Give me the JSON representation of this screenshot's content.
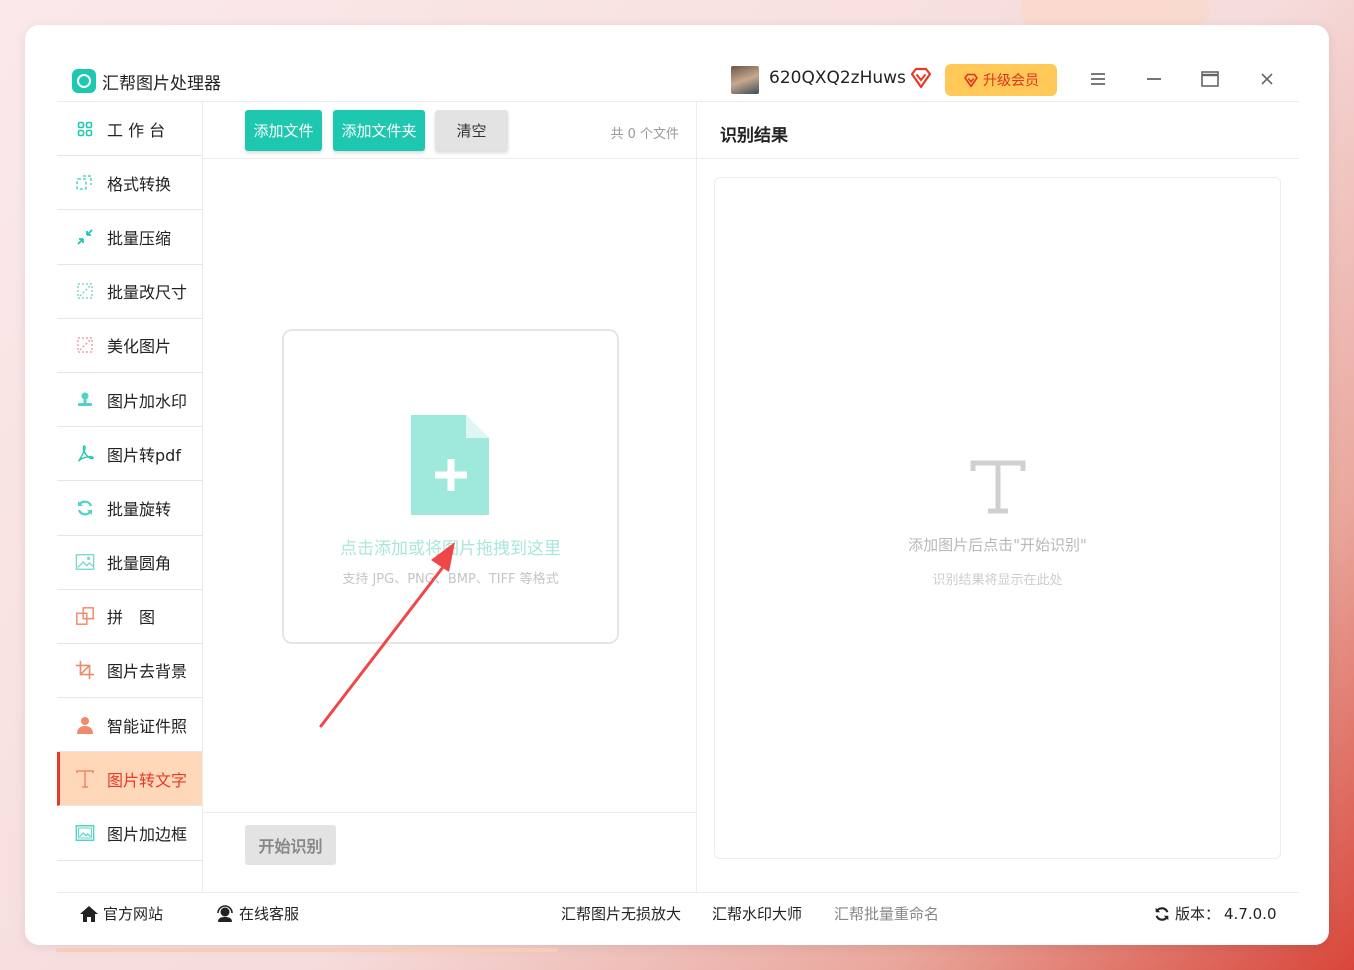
{
  "app": {
    "title": "汇帮图片处理器"
  },
  "user": {
    "name": "620QXQ2zHuws"
  },
  "header": {
    "upgrade_label": "升级会员"
  },
  "sidebar": {
    "items": [
      {
        "label": "工 作 台",
        "icon": "grid-icon"
      },
      {
        "label": "格式转换",
        "icon": "convert-icon"
      },
      {
        "label": "批量压缩",
        "icon": "compress-icon"
      },
      {
        "label": "批量改尺寸",
        "icon": "resize-icon"
      },
      {
        "label": "美化图片",
        "icon": "beautify-icon"
      },
      {
        "label": "图片加水印",
        "icon": "stamp-icon"
      },
      {
        "label": "图片转pdf",
        "icon": "pdf-icon"
      },
      {
        "label": "批量旋转",
        "icon": "rotate-icon"
      },
      {
        "label": "批量圆角",
        "icon": "image-icon"
      },
      {
        "label": "拼　图",
        "icon": "puzzle-icon"
      },
      {
        "label": "图片去背景",
        "icon": "crop-icon"
      },
      {
        "label": "智能证件照",
        "icon": "person-icon"
      },
      {
        "label": "图片转文字",
        "icon": "text-icon",
        "active": true
      },
      {
        "label": "图片加边框",
        "icon": "frame-icon"
      }
    ]
  },
  "toolbar": {
    "add_file": "添加文件",
    "add_folder": "添加文件夹",
    "clear": "清空",
    "file_count": "共 0 个文件"
  },
  "dropzone": {
    "text": "点击添加或将图片拖拽到这里",
    "formats": "支持 JPG、PNG、BMP、TIFF 等格式"
  },
  "actions": {
    "start": "开始识别"
  },
  "result": {
    "title": "识别结果",
    "hint": "添加图片后点击\"开始识别\"",
    "sub": "识别结果将显示在此处"
  },
  "footer": {
    "site": "官方网站",
    "service": "在线客服",
    "upscale": "汇帮图片无损放大",
    "watermark": "汇帮水印大师",
    "rename": "汇帮批量重命名",
    "version_label": "版本：",
    "version": "4.7.0.0"
  },
  "colors": {
    "accent": "#1ec7b0",
    "active_bg": "#ffd7b9",
    "active_text": "#e63a28",
    "upgrade_bg": "#ffc857",
    "arrow": "#ef4747"
  }
}
